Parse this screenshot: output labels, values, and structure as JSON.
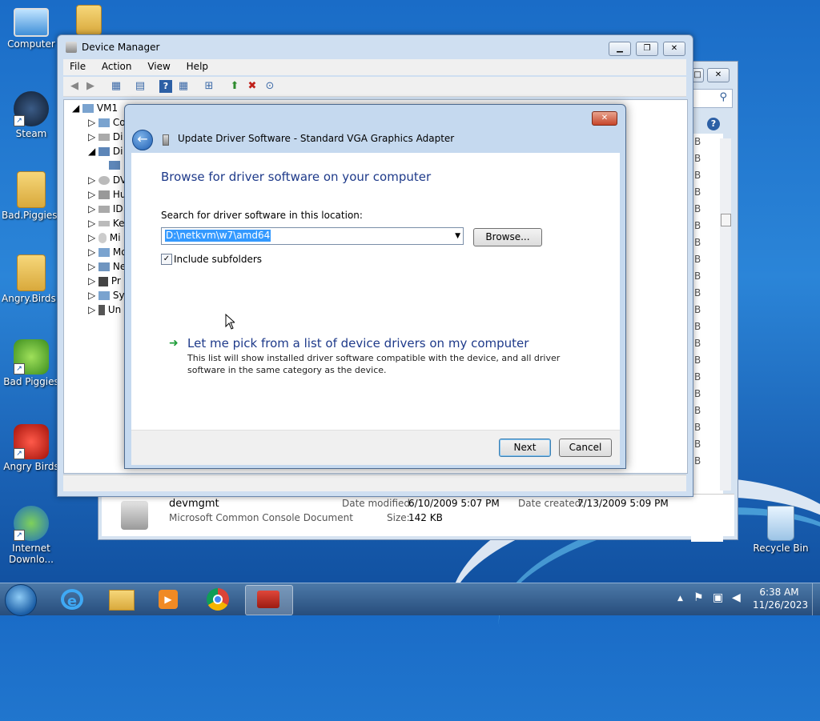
{
  "desktop": {
    "icons": [
      {
        "label": "Computer"
      },
      {
        "label": "Steam"
      },
      {
        "label": "Bad.Piggies..."
      },
      {
        "label": "Angry.Birds..."
      },
      {
        "label": "Bad Piggies"
      },
      {
        "label": "Angry Birds"
      },
      {
        "label": "Internet Downlo..."
      },
      {
        "label": "Recycle Bin"
      }
    ]
  },
  "explorer": {
    "list_items": [
      "B",
      "B",
      "B",
      "B",
      "B",
      "B",
      "B",
      "B",
      "B",
      "B",
      "B",
      "B",
      "B",
      "B",
      "B",
      "B",
      "B",
      "B",
      "B",
      "B"
    ],
    "details": {
      "name": "devmgmt",
      "type": "Microsoft Common Console Document",
      "date_modified_label": "Date modified:",
      "date_modified": "6/10/2009 5:07 PM",
      "date_created_label": "Date created:",
      "date_created": "7/13/2009 5:09 PM",
      "size_label": "Size:",
      "size": "142 KB"
    }
  },
  "device_manager": {
    "title": "Device Manager",
    "menu": [
      "File",
      "Action",
      "View",
      "Help"
    ],
    "tree_root": "VM1",
    "tree_items": [
      "Co",
      "Di",
      "Di",
      "DV",
      "Hu",
      "ID",
      "Ke",
      "Mi",
      "Mo",
      "Ne",
      "Pr",
      "Sy",
      "Un"
    ]
  },
  "dialog": {
    "title": "Update Driver Software - Standard VGA Graphics Adapter",
    "heading": "Browse for driver software on your computer",
    "search_label": "Search for driver software in this location:",
    "path_value": "D:\\netkvm\\w7\\amd64",
    "browse_label": "Browse...",
    "include_subfolders_label": "Include subfolders",
    "include_subfolders_checked": true,
    "pick_link": "Let me pick from a list of device drivers on my computer",
    "pick_desc_line1": "This list will show installed driver software compatible with the device, and all driver",
    "pick_desc_line2": "software in the same category as the device.",
    "next_label": "Next",
    "cancel_label": "Cancel"
  },
  "taskbar": {
    "time": "6:38 AM",
    "date": "11/26/2023"
  }
}
